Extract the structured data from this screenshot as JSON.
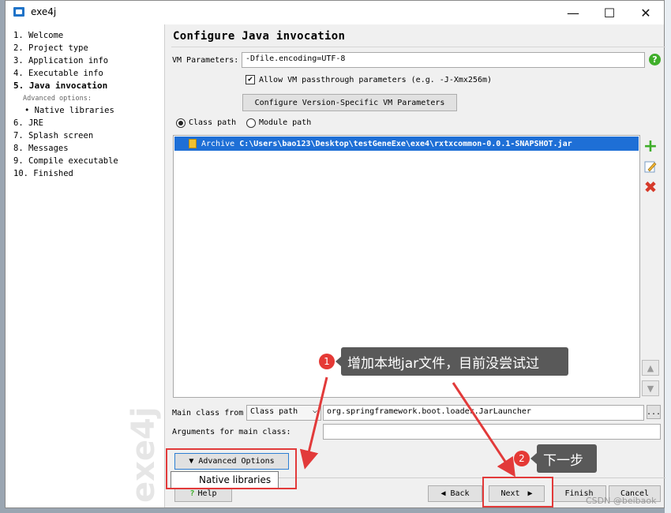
{
  "window": {
    "title": "exe4j",
    "minimize": "—",
    "maximize": "☐",
    "close": "✕"
  },
  "steps": [
    "1. Welcome",
    "2. Project type",
    "3. Application info",
    "4. Executable info",
    "5. Java invocation",
    "Advanced options:",
    "• Native libraries",
    "6. JRE",
    "7. Splash screen",
    "8. Messages",
    "9. Compile executable",
    "10. Finished"
  ],
  "watermark": "exe4j",
  "page": {
    "heading": "Configure Java invocation",
    "vm_params_label": "VM Parameters:",
    "vm_params_value": "-Dfile.encoding=UTF-8",
    "help_glyph": "?",
    "allow_passthrough": "Allow VM passthrough parameters (e.g. -J-Xmx256m)",
    "allow_passthrough_checked": true,
    "version_specific_button": "Configure Version-Specific VM Parameters",
    "radio_classpath": "Class path",
    "radio_modulepath": "Module path",
    "classpath_entries": [
      {
        "type": "Archive",
        "path": "C:\\Users\\bao123\\Desktop\\testGeneExe\\exe4\\rxtxcommon-0.0.1-SNAPSHOT.jar"
      }
    ],
    "main_class_label": "Main class from",
    "main_class_from": "Class path",
    "main_class_value": "org.springframework.boot.loader.JarLauncher",
    "browse_button": "...",
    "args_label": "Arguments for main class:",
    "args_value": "",
    "advanced_options": "Advanced Options",
    "advanced_menu_item": "Native libraries"
  },
  "buttons": {
    "help": "Help",
    "back": "Back",
    "next": "Next",
    "finish": "Finish",
    "cancel": "Cancel"
  },
  "annotations": {
    "callout1_number": "1",
    "callout1_text": "增加本地jar文件，目前没尝试过",
    "callout2_number": "2",
    "callout2_text": "下一步",
    "credit": "CSDN @beibaok"
  },
  "colors": {
    "selection": "#1e6fd6",
    "annotation_red": "#e23a3a",
    "callout_bg": "#595959",
    "add_green": "#3fae2a"
  }
}
